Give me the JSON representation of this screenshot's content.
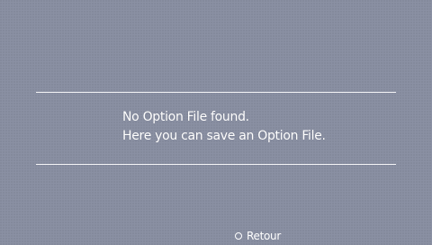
{
  "dialog": {
    "message_line_1": "No Option File found.",
    "message_line_2": "Here you can save an Option File."
  },
  "footer": {
    "back_icon": "circle-button-icon",
    "back_label": "Retour"
  },
  "colors": {
    "background": "#8a90a3",
    "text": "#ffffff",
    "divider": "#f4f4f6"
  }
}
